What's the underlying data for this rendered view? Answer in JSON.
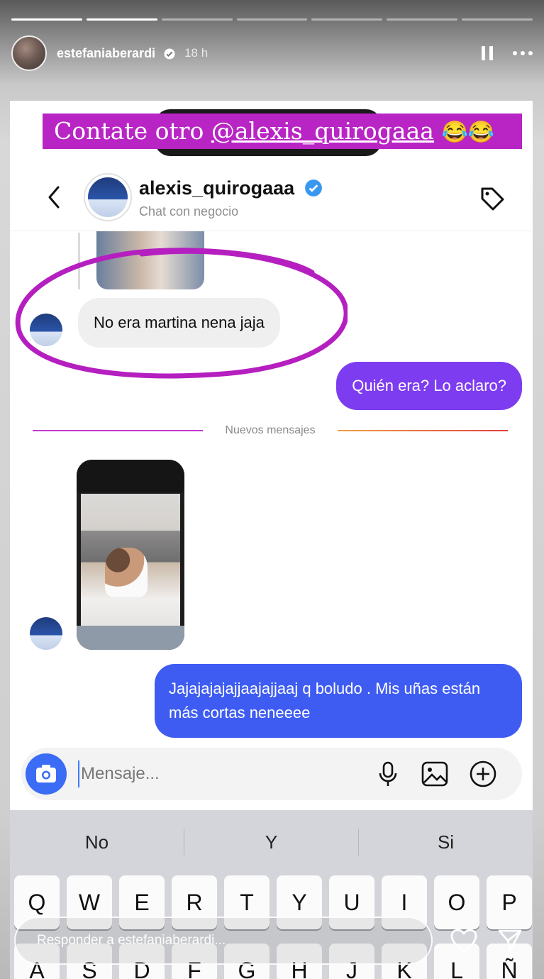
{
  "story": {
    "username": "estefaniaberardi",
    "time": "18 h",
    "progress_segments_total": 7,
    "progress_segments_done": 2,
    "reply_placeholder": "Responder a estefaniaberardi..."
  },
  "caption": {
    "prefix": "Contate otro ",
    "mention": "@alexis_quirogaaa",
    "emoji": "😂😂"
  },
  "chat": {
    "name": "alexis_quirogaaa",
    "subtitle": "Chat con negocio",
    "messages": {
      "incoming_1": "No era martina nena jaja",
      "outgoing_1": "Quién era? Lo aclaro?",
      "outgoing_2": "Jajajajajajjaajajjaaj q boludo . Mis uñas están más cortas neneeee"
    },
    "divider_label": "Nuevos mensajes",
    "composer_placeholder": "Mensaje..."
  },
  "keyboard": {
    "suggestions": [
      "No",
      "Y",
      "Si"
    ],
    "row1": [
      "Q",
      "W",
      "E",
      "R",
      "T",
      "Y",
      "U",
      "I",
      "O",
      "P"
    ],
    "row2": [
      "A",
      "S",
      "D",
      "F",
      "G",
      "H",
      "J",
      "K",
      "L",
      "Ñ"
    ]
  },
  "colors": {
    "caption_bg": "#b825c4",
    "outgoing_purple": "#7d3cf0",
    "outgoing_blue": "#3e5cf2",
    "verified_blue": "#3897f0",
    "camera_blue": "#3b6cf5"
  }
}
